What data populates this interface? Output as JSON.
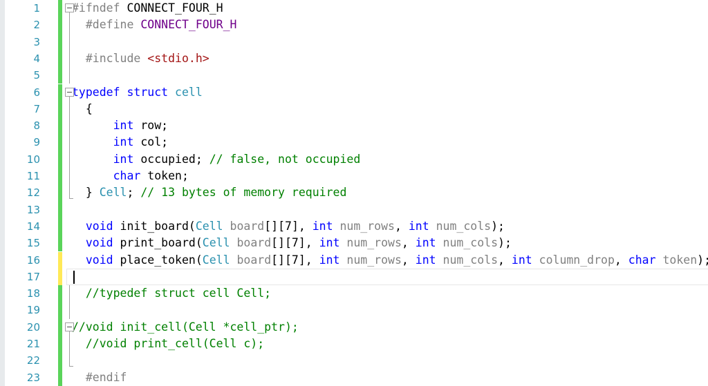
{
  "editor": {
    "language": "C/C++ header",
    "filename_hint": "connect_four.h",
    "colors": {
      "background": "#ffffff",
      "line_number": "#2b91af",
      "keyword": "#0000ff",
      "user_type": "#2b91af",
      "preprocessor": "#808080",
      "macro_name": "#6f008a",
      "string_include": "#a31515",
      "comment": "#008000",
      "change_saved": "#5ad45a",
      "change_unsaved": "#ffe957",
      "fold_line": "#a0a0a0",
      "current_line_border": "#e6e6e6"
    },
    "cursor": {
      "line": 17,
      "column": 1
    },
    "lines": [
      {
        "number": "1",
        "change": "green",
        "fold": "box",
        "tokens": [
          {
            "t": "#ifndef ",
            "c": "pre"
          },
          {
            "t": "CONNECT_FOUR_H",
            "c": "plain"
          }
        ]
      },
      {
        "number": "2",
        "change": "green",
        "fold": "line",
        "tokens": [
          {
            "t": "  ",
            "c": "plain"
          },
          {
            "t": "#define ",
            "c": "pre"
          },
          {
            "t": "CONNECT_FOUR_H",
            "c": "macro"
          }
        ]
      },
      {
        "number": "3",
        "change": "green",
        "fold": "line",
        "tokens": []
      },
      {
        "number": "4",
        "change": "green",
        "fold": "line",
        "tokens": [
          {
            "t": "  ",
            "c": "plain"
          },
          {
            "t": "#include ",
            "c": "pre"
          },
          {
            "t": "<stdio.h>",
            "c": "str"
          }
        ]
      },
      {
        "number": "5",
        "change": "green",
        "fold": "line",
        "tokens": []
      },
      {
        "number": "6",
        "change": "green",
        "fold": "box",
        "tokens": [
          {
            "t": "typedef",
            "c": "kw"
          },
          {
            "t": " ",
            "c": "plain"
          },
          {
            "t": "struct",
            "c": "kw"
          },
          {
            "t": " ",
            "c": "plain"
          },
          {
            "t": "cell",
            "c": "type"
          }
        ]
      },
      {
        "number": "7",
        "change": "green",
        "fold": "line",
        "tokens": [
          {
            "t": "  {",
            "c": "plain"
          }
        ]
      },
      {
        "number": "8",
        "change": "green",
        "fold": "line",
        "tokens": [
          {
            "t": "      ",
            "c": "plain"
          },
          {
            "t": "int",
            "c": "kw"
          },
          {
            "t": " row;",
            "c": "plain"
          }
        ]
      },
      {
        "number": "9",
        "change": "green",
        "fold": "line",
        "tokens": [
          {
            "t": "      ",
            "c": "plain"
          },
          {
            "t": "int",
            "c": "kw"
          },
          {
            "t": " col;",
            "c": "plain"
          }
        ]
      },
      {
        "number": "10",
        "change": "green",
        "fold": "line",
        "tokens": [
          {
            "t": "      ",
            "c": "plain"
          },
          {
            "t": "int",
            "c": "kw"
          },
          {
            "t": " occupied; ",
            "c": "plain"
          },
          {
            "t": "// false, not occupied",
            "c": "comment"
          }
        ]
      },
      {
        "number": "11",
        "change": "green",
        "fold": "line",
        "tokens": [
          {
            "t": "      ",
            "c": "plain"
          },
          {
            "t": "char",
            "c": "kw"
          },
          {
            "t": " token;",
            "c": "plain"
          }
        ]
      },
      {
        "number": "12",
        "change": "green",
        "fold": "foot",
        "tokens": [
          {
            "t": "  } ",
            "c": "plain"
          },
          {
            "t": "Cell",
            "c": "type"
          },
          {
            "t": "; ",
            "c": "plain"
          },
          {
            "t": "// 13 bytes of memory required",
            "c": "comment"
          }
        ]
      },
      {
        "number": "13",
        "change": "green",
        "fold": "none",
        "tokens": []
      },
      {
        "number": "14",
        "change": "green",
        "fold": "none",
        "tokens": [
          {
            "t": "  ",
            "c": "plain"
          },
          {
            "t": "void",
            "c": "kw"
          },
          {
            "t": " init_board(",
            "c": "plain"
          },
          {
            "t": "Cell",
            "c": "type"
          },
          {
            "t": " ",
            "c": "plain"
          },
          {
            "t": "board",
            "c": "param"
          },
          {
            "t": "[][7], ",
            "c": "plain"
          },
          {
            "t": "int",
            "c": "kw"
          },
          {
            "t": " ",
            "c": "plain"
          },
          {
            "t": "num_rows",
            "c": "param"
          },
          {
            "t": ", ",
            "c": "plain"
          },
          {
            "t": "int",
            "c": "kw"
          },
          {
            "t": " ",
            "c": "plain"
          },
          {
            "t": "num_cols",
            "c": "param"
          },
          {
            "t": ");",
            "c": "plain"
          }
        ]
      },
      {
        "number": "15",
        "change": "green",
        "fold": "none",
        "tokens": [
          {
            "t": "  ",
            "c": "plain"
          },
          {
            "t": "void",
            "c": "kw"
          },
          {
            "t": " print_board(",
            "c": "plain"
          },
          {
            "t": "Cell",
            "c": "type"
          },
          {
            "t": " ",
            "c": "plain"
          },
          {
            "t": "board",
            "c": "param"
          },
          {
            "t": "[][7], ",
            "c": "plain"
          },
          {
            "t": "int",
            "c": "kw"
          },
          {
            "t": " ",
            "c": "plain"
          },
          {
            "t": "num_rows",
            "c": "param"
          },
          {
            "t": ", ",
            "c": "plain"
          },
          {
            "t": "int",
            "c": "kw"
          },
          {
            "t": " ",
            "c": "plain"
          },
          {
            "t": "num_cols",
            "c": "param"
          },
          {
            "t": ");",
            "c": "plain"
          }
        ]
      },
      {
        "number": "16",
        "change": "yellow",
        "fold": "none",
        "tokens": [
          {
            "t": "  ",
            "c": "plain"
          },
          {
            "t": "void",
            "c": "kw"
          },
          {
            "t": " place_token(",
            "c": "plain"
          },
          {
            "t": "Cell",
            "c": "type"
          },
          {
            "t": " ",
            "c": "plain"
          },
          {
            "t": "board",
            "c": "param"
          },
          {
            "t": "[][7], ",
            "c": "plain"
          },
          {
            "t": "int",
            "c": "kw"
          },
          {
            "t": " ",
            "c": "plain"
          },
          {
            "t": "num_rows",
            "c": "param"
          },
          {
            "t": ", ",
            "c": "plain"
          },
          {
            "t": "int",
            "c": "kw"
          },
          {
            "t": " ",
            "c": "plain"
          },
          {
            "t": "num_cols",
            "c": "param"
          },
          {
            "t": ", ",
            "c": "plain"
          },
          {
            "t": "int",
            "c": "kw"
          },
          {
            "t": " ",
            "c": "plain"
          },
          {
            "t": "column_drop",
            "c": "param"
          },
          {
            "t": ", ",
            "c": "plain"
          },
          {
            "t": "char",
            "c": "kw"
          },
          {
            "t": " ",
            "c": "plain"
          },
          {
            "t": "token",
            "c": "param"
          },
          {
            "t": ");",
            "c": "plain"
          }
        ]
      },
      {
        "number": "17",
        "change": "yellow",
        "fold": "none",
        "current": true,
        "tokens": []
      },
      {
        "number": "18",
        "change": "green",
        "fold": "line",
        "tokens": [
          {
            "t": "  ",
            "c": "plain"
          },
          {
            "t": "//typedef struct cell Cell;",
            "c": "comment"
          }
        ]
      },
      {
        "number": "19",
        "change": "green",
        "fold": "line",
        "tokens": []
      },
      {
        "number": "20",
        "change": "green",
        "fold": "box",
        "tokens": [
          {
            "t": "//void init_cell(Cell *cell_ptr);",
            "c": "comment"
          }
        ]
      },
      {
        "number": "21",
        "change": "green",
        "fold": "line",
        "tokens": [
          {
            "t": "  ",
            "c": "plain"
          },
          {
            "t": "//void print_cell(Cell c);",
            "c": "comment"
          }
        ]
      },
      {
        "number": "22",
        "change": "green",
        "fold": "foot",
        "tokens": []
      },
      {
        "number": "23",
        "change": "green",
        "fold": "none",
        "tokens": [
          {
            "t": "  ",
            "c": "plain"
          },
          {
            "t": "#endif",
            "c": "pre"
          }
        ]
      }
    ]
  }
}
